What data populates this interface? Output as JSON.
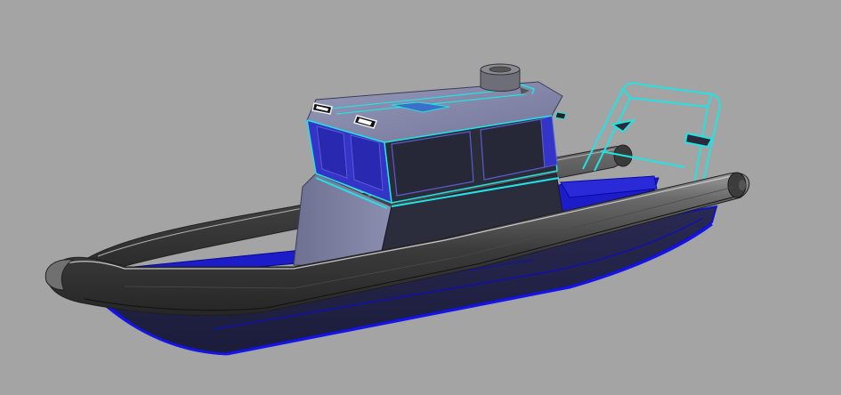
{
  "scene": {
    "subject": "rigid-inflatable-boat-cad-render",
    "colors": {
      "background": "#a4a4a4",
      "tube_dark": "#2e2e2e",
      "tube_mid": "#505050",
      "tube_light": "#8a8a8a",
      "hull_blue": "#0000c8",
      "hull_deep": "#1a1a8a",
      "cabin_body": "#2b2d3d",
      "cabin_side": "#7c7ea0",
      "roof": "#8486a6",
      "window_blue": "#3a36d6",
      "edge_highlight": "#21e3e3"
    },
    "parts": [
      "inflatable-collar",
      "hull",
      "deck",
      "console-cabin",
      "windshield",
      "roof",
      "exhaust-stack",
      "roof-lights",
      "radar-arch"
    ]
  }
}
